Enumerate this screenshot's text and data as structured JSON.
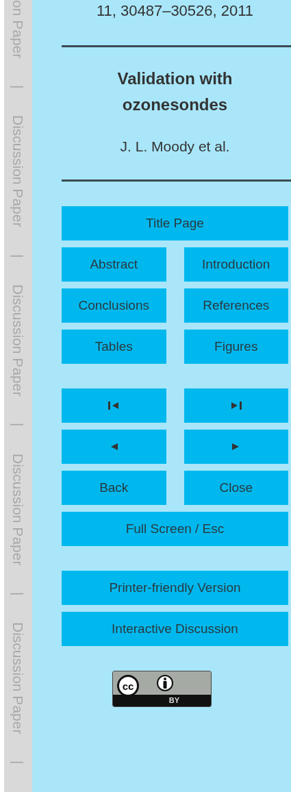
{
  "margin": [
    "on Paper",
    "|",
    "Discussion Paper",
    "|",
    "Discussion Paper",
    "|",
    "Discussion Paper",
    "|",
    "Discussion Paper",
    "|"
  ],
  "header": {
    "citation": "11, 30487–30526, 2011",
    "title": "Validation with ozonesondes",
    "authors": "J. L. Moody et al."
  },
  "nav_groups": [
    [
      [
        {
          "kind": "text",
          "label": "Title Page"
        }
      ],
      [
        {
          "kind": "text",
          "label": "Abstract"
        },
        {
          "kind": "text",
          "label": "Introduction"
        }
      ],
      [
        {
          "kind": "text",
          "label": "Conclusions"
        },
        {
          "kind": "text",
          "label": "References"
        }
      ],
      [
        {
          "kind": "text",
          "label": "Tables"
        },
        {
          "kind": "text",
          "label": "Figures"
        }
      ]
    ],
    [
      [
        {
          "kind": "first"
        },
        {
          "kind": "last"
        }
      ],
      [
        {
          "kind": "prev"
        },
        {
          "kind": "next"
        }
      ],
      [
        {
          "kind": "text",
          "label": "Back"
        },
        {
          "kind": "text",
          "label": "Close"
        }
      ],
      [
        {
          "kind": "text",
          "label": "Full Screen / Esc"
        }
      ]
    ],
    [
      [
        {
          "kind": "text",
          "label": "Printer-friendly Version"
        }
      ],
      [
        {
          "kind": "text",
          "label": "Interactive Discussion"
        }
      ]
    ]
  ],
  "license": {
    "logo": "cc",
    "label": "BY"
  }
}
